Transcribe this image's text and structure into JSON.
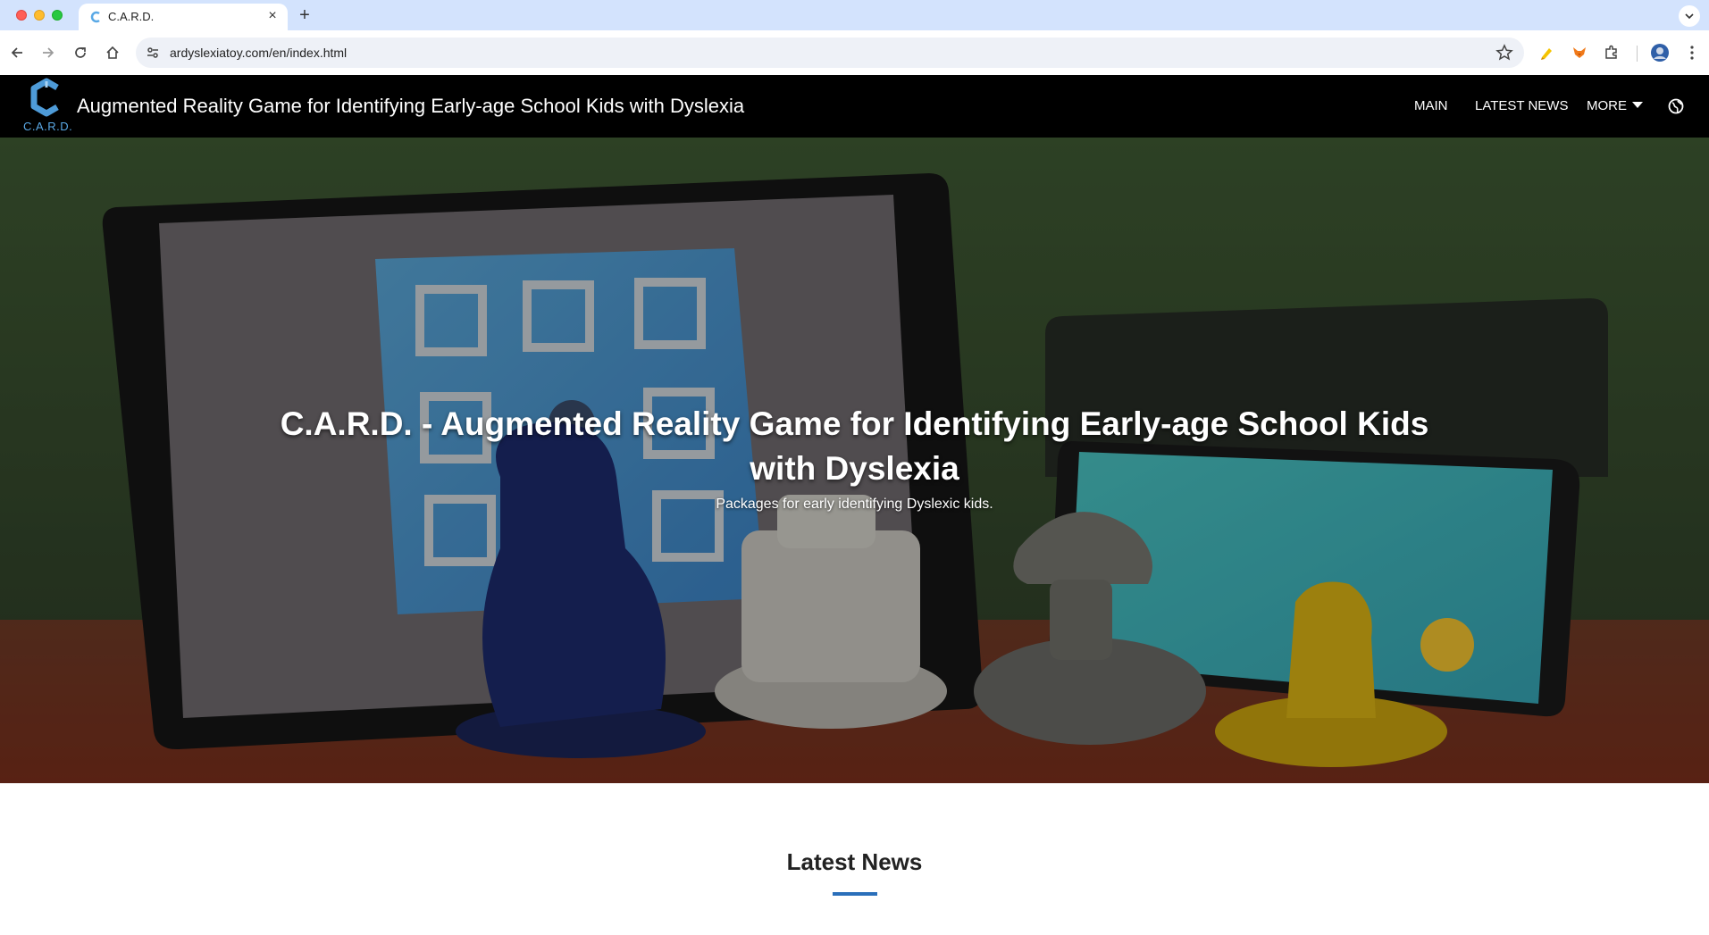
{
  "browser": {
    "tab_title": "C.A.R.D.",
    "url": "ardyslexiatoy.com/en/index.html",
    "icons": [
      "back-icon",
      "forward-icon",
      "reload-icon",
      "home-icon",
      "site-settings-icon",
      "bookmark-star-icon",
      "extension-highlighter-icon",
      "extension-fox-icon",
      "extensions-puzzle-icon",
      "profile-avatar-icon",
      "menu-kebab-icon"
    ]
  },
  "nav": {
    "logo_text": "C.A.R.D.",
    "site_title": "Augmented Reality Game for Identifying Early-age School Kids with Dyslexia",
    "items": [
      {
        "label": "MAIN"
      },
      {
        "label": "LATEST NEWS"
      },
      {
        "label": "MORE"
      }
    ],
    "language_icon": "globe-icon"
  },
  "hero": {
    "title": "C.A.R.D. - Augmented Reality Game for Identifying Early-age School Kids with Dyslexia",
    "subtitle": "Packages for early identifying Dyslexic kids."
  },
  "news": {
    "heading": "Latest News",
    "accent_color": "#2a6fba"
  }
}
